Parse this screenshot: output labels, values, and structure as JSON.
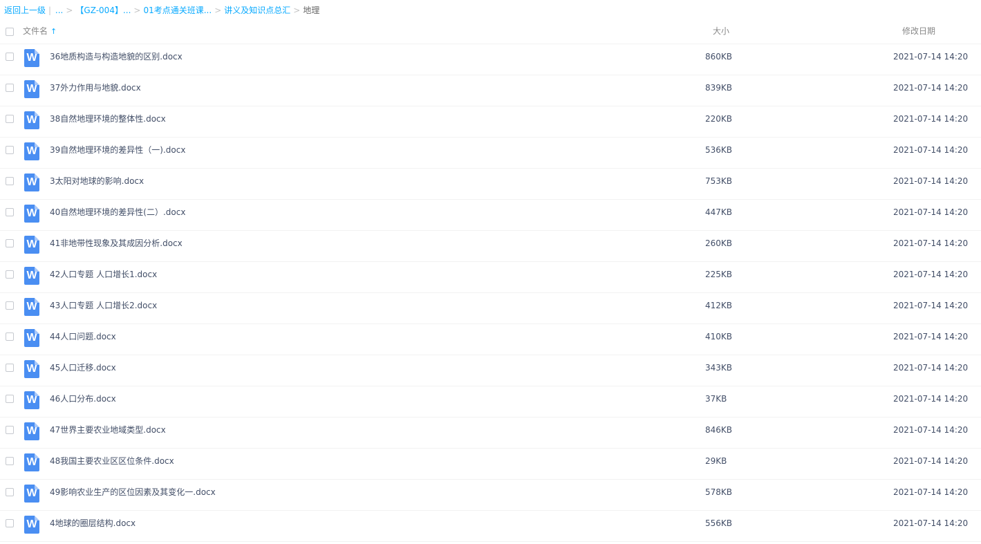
{
  "breadcrumb": {
    "back": "返回上一级",
    "ellipsis": "...",
    "items": [
      "【GZ-004】...",
      "01考点通关班课...",
      "讲义及知识点总汇"
    ],
    "current": "地理"
  },
  "header": {
    "name_label": "文件名",
    "sort_arrow": "↑",
    "size_label": "大小",
    "date_label": "修改日期"
  },
  "files": [
    {
      "icon": "W",
      "name": "36地质构造与构造地貌的区别.docx",
      "size": "860KB",
      "date": "2021-07-14 14:20"
    },
    {
      "icon": "W",
      "name": "37外力作用与地貌.docx",
      "size": "839KB",
      "date": "2021-07-14 14:20"
    },
    {
      "icon": "W",
      "name": "38自然地理环境的整体性.docx",
      "size": "220KB",
      "date": "2021-07-14 14:20"
    },
    {
      "icon": "W",
      "name": "39自然地理环境的差异性（一).docx",
      "size": "536KB",
      "date": "2021-07-14 14:20"
    },
    {
      "icon": "W",
      "name": "3太阳对地球的影响.docx",
      "size": "753KB",
      "date": "2021-07-14 14:20"
    },
    {
      "icon": "W",
      "name": "40自然地理环境的差异性(二）.docx",
      "size": "447KB",
      "date": "2021-07-14 14:20"
    },
    {
      "icon": "W",
      "name": "41非地带性现象及其成因分析.docx",
      "size": "260KB",
      "date": "2021-07-14 14:20"
    },
    {
      "icon": "W",
      "name": "42人口专题 人口增长1.docx",
      "size": "225KB",
      "date": "2021-07-14 14:20"
    },
    {
      "icon": "W",
      "name": "43人口专题 人口增长2.docx",
      "size": "412KB",
      "date": "2021-07-14 14:20"
    },
    {
      "icon": "W",
      "name": "44人口问题.docx",
      "size": "410KB",
      "date": "2021-07-14 14:20"
    },
    {
      "icon": "W",
      "name": "45人口迁移.docx",
      "size": "343KB",
      "date": "2021-07-14 14:20"
    },
    {
      "icon": "W",
      "name": "46人口分布.docx",
      "size": "37KB",
      "date": "2021-07-14 14:20"
    },
    {
      "icon": "W",
      "name": "47世界主要农业地域类型.docx",
      "size": "846KB",
      "date": "2021-07-14 14:20"
    },
    {
      "icon": "W",
      "name": "48我国主要农业区区位条件.docx",
      "size": "29KB",
      "date": "2021-07-14 14:20"
    },
    {
      "icon": "W",
      "name": "49影响农业生产的区位因素及其变化一.docx",
      "size": "578KB",
      "date": "2021-07-14 14:20"
    },
    {
      "icon": "W",
      "name": "4地球的圈层结构.docx",
      "size": "556KB",
      "date": "2021-07-14 14:20"
    }
  ]
}
